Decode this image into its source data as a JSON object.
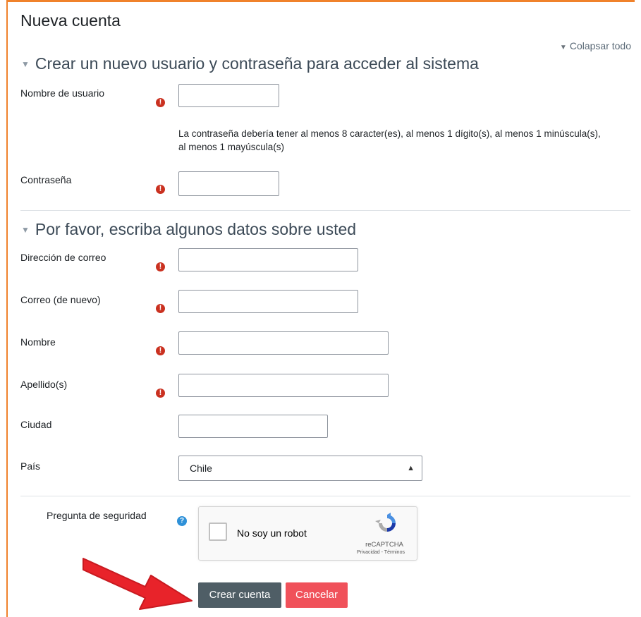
{
  "page": {
    "title": "Nueva cuenta",
    "collapse_all": "Colapsar todo"
  },
  "sections": {
    "account": {
      "title": "Crear un nuevo usuario y contraseña para acceder al sistema"
    },
    "details": {
      "title": "Por favor, escriba algunos datos sobre usted"
    }
  },
  "fields": {
    "username": {
      "label": "Nombre de usuario",
      "value": ""
    },
    "password_hint": "La contraseña debería tener al menos 8 caracter(es), al menos 1 dígito(s), al menos 1 minúscula(s), al menos 1 mayúscula(s)",
    "password": {
      "label": "Contraseña",
      "value": ""
    },
    "email": {
      "label": "Dirección de correo",
      "value": ""
    },
    "email2": {
      "label": "Correo (de nuevo)",
      "value": ""
    },
    "firstname": {
      "label": "Nombre",
      "value": ""
    },
    "lastname": {
      "label": "Apellido(s)",
      "value": ""
    },
    "city": {
      "label": "Ciudad",
      "value": ""
    },
    "country": {
      "label": "País",
      "selected": "Chile"
    },
    "security": {
      "label": "Pregunta de seguridad"
    }
  },
  "required_icon": "exclamation-circle-icon",
  "help_icon": "question-circle-icon",
  "captcha": {
    "checkbox_label": "No soy un robot",
    "brand": "reCAPTCHA",
    "links": "Privacidad - Términos"
  },
  "buttons": {
    "submit": "Crear cuenta",
    "cancel": "Cancelar"
  },
  "colors": {
    "accent_border": "#f0822b",
    "primary_button": "#4f5e66",
    "cancel_button": "#f0515a",
    "required": "#ca3120",
    "annotation_arrow": "#e8232a"
  }
}
